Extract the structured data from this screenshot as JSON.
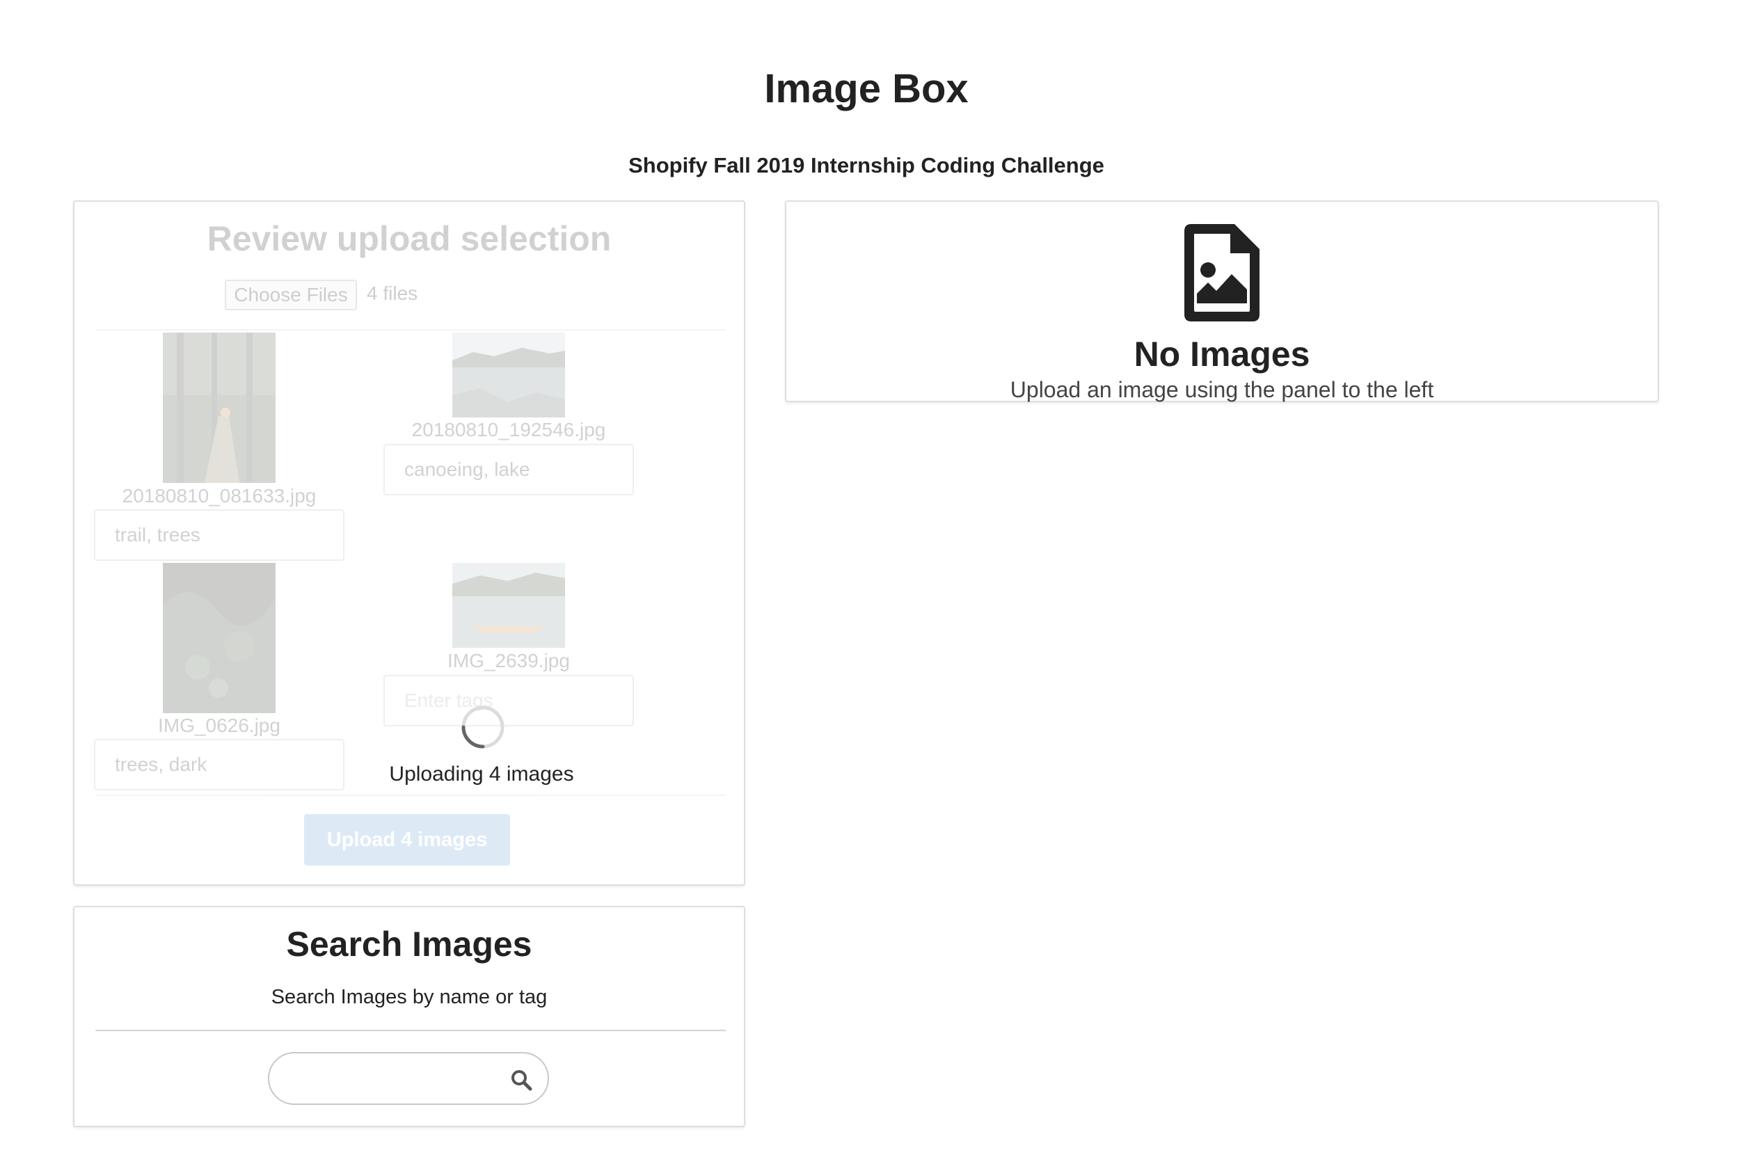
{
  "header": {
    "title": "Image Box",
    "subtitle": "Shopify Fall 2019 Internship Coding Challenge"
  },
  "upload_panel": {
    "heading": "Review upload selection",
    "choose_files_label": "Choose Files",
    "file_count": "4 files",
    "images": [
      {
        "filename": "20180810_081633.jpg",
        "tags": "trail, trees",
        "placeholder": "Enter tags"
      },
      {
        "filename": "20180810_192546.jpg",
        "tags": "canoeing, lake",
        "placeholder": "Enter tags"
      },
      {
        "filename": "IMG_0626.jpg",
        "tags": "trees, dark",
        "placeholder": "Enter tags"
      },
      {
        "filename": "IMG_2639.jpg",
        "tags": "",
        "placeholder": "Enter tags"
      }
    ],
    "upload_button_label": "Upload 4 images",
    "uploading_status": "Uploading 4 images"
  },
  "search_panel": {
    "heading": "Search Images",
    "subheading": "Search Images by name or tag",
    "search_value": "",
    "search_icon": "search-icon"
  },
  "gallery": {
    "empty_icon": "file-image-icon",
    "empty_title": "No Images",
    "empty_subtitle": "Upload an image using the panel to the left"
  },
  "colors": {
    "upload_button": "#6aa3d9",
    "text": "#222222",
    "border": "#dedede"
  }
}
